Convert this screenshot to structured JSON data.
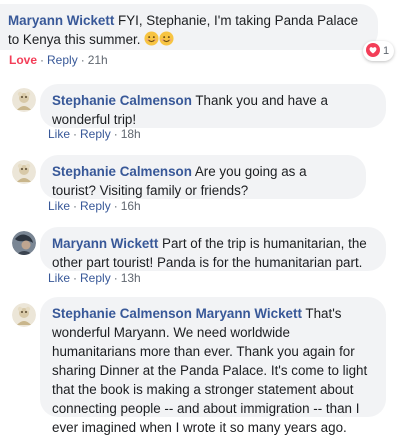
{
  "colors": {
    "author": "#385898",
    "bubble_bg": "#f2f3f5",
    "text": "#1c1e21",
    "meta": "#606770",
    "love": "#f33e58"
  },
  "comments": [
    {
      "author": "Maryann Wickett",
      "text": "FYI, Stephanie, I'm taking Panda Palace to Kenya this summer.",
      "emoji": "smiling-face-icon x2",
      "reaction_state": "Love",
      "reply_label": "Reply",
      "time": "21h",
      "reaction_count": "1",
      "reaction_icon": "heart-icon"
    },
    {
      "author": "Stephanie Calmenson",
      "text": "Thank you and have a wonderful trip!",
      "like_label": "Like",
      "reply_label": "Reply",
      "time": "18h"
    },
    {
      "author": "Stephanie Calmenson",
      "text": "Are you going as a tourist? Visiting family or friends?",
      "like_label": "Like",
      "reply_label": "Reply",
      "time": "16h"
    },
    {
      "author": "Maryann Wickett",
      "text": "Part of the trip is humanitarian, the other part tourist! Panda is for the humanitarian part.",
      "like_label": "Like",
      "reply_label": "Reply",
      "time": "13h"
    },
    {
      "author": "Stephanie Calmenson",
      "mention": "Maryann Wickett",
      "text": "That's wonderful Maryann. We need worldwide humanitarians more than ever. Thank you again for sharing Dinner at the Panda Palace. It's come to light that the book is making a stronger statement about connecting people -- and about immigration -- than I ever imagined when I wrote it so many years ago."
    }
  ],
  "separator": "·"
}
